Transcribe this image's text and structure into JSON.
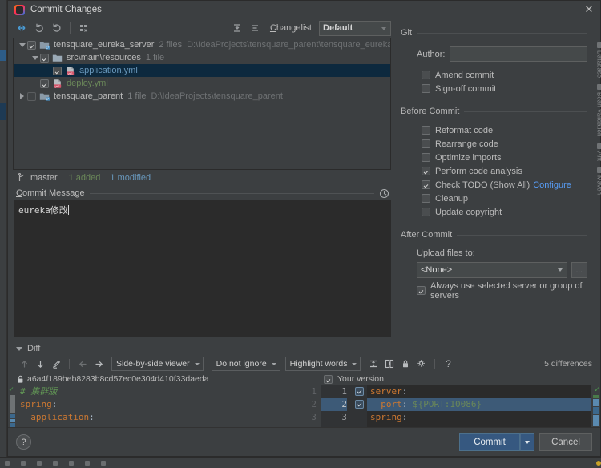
{
  "window": {
    "title": "Commit Changes",
    "app_icon": "intellij-idea-icon",
    "close_label": "✕"
  },
  "changes_toolbar": {
    "buttons": [
      {
        "name": "show-diff-icon",
        "title": "Show Diff"
      },
      {
        "name": "revert-icon",
        "title": "Revert"
      },
      {
        "name": "refresh-icon",
        "title": "Refresh"
      },
      {
        "name": "group-by-icon",
        "title": "Group By"
      }
    ],
    "expand_all": "expand-all-icon",
    "collapse_all": "collapse-all-icon",
    "changelist_label": "Changelist:",
    "changelist_value": "Default"
  },
  "tree": [
    {
      "indent": 0,
      "twisty": "open",
      "checked": true,
      "icon": "module-folder-icon",
      "name": "tensquare_eureka_server",
      "color": "default",
      "meta": "2 files",
      "path": "D:\\IdeaProjects\\tensquare_parent\\tensquare_eureka_server",
      "selected": false
    },
    {
      "indent": 1,
      "twisty": "open",
      "checked": true,
      "icon": "folder-icon",
      "name": "src\\main\\resources",
      "color": "default",
      "meta": "1 file",
      "path": "",
      "selected": false
    },
    {
      "indent": 2,
      "twisty": "none",
      "checked": true,
      "icon": "yaml-file-icon",
      "name": "application.yml",
      "color": "blue",
      "meta": "",
      "path": "",
      "selected": true
    },
    {
      "indent": 1,
      "twisty": "none",
      "checked": true,
      "icon": "yaml-file-icon",
      "name": "deploy.yml",
      "color": "green",
      "meta": "",
      "path": "",
      "selected": false
    },
    {
      "indent": 0,
      "twisty": "closed",
      "checked": false,
      "icon": "module-folder-icon",
      "name": "tensquare_parent",
      "color": "default",
      "meta": "1 file",
      "path": "D:\\IdeaProjects\\tensquare_parent",
      "selected": false
    }
  ],
  "branch_strip": {
    "branch_icon": "vcs-branch-icon",
    "branch": "master",
    "added": "1 added",
    "modified": "1 modified"
  },
  "commit_message": {
    "label": "Commit Message",
    "label_mnemonic": "C",
    "history_icon": "clock-history-icon",
    "value": "eureka修改"
  },
  "git_group": {
    "title": "Git",
    "author_label": "Author:",
    "author_mnemonic": "A",
    "author_value": "",
    "author_placeholder": "",
    "checkboxes": [
      {
        "label": "Amend commit",
        "mnemonic": "m",
        "checked": false,
        "name": "amend-commit-checkbox"
      },
      {
        "label": "Sign-off commit",
        "mnemonic": "",
        "checked": false,
        "name": "sign-off-commit-checkbox"
      }
    ]
  },
  "before_commit": {
    "title": "Before Commit",
    "checkboxes": [
      {
        "label": "Reformat code",
        "checked": false,
        "name": "reformat-code-checkbox",
        "link": ""
      },
      {
        "label": "Rearrange code",
        "checked": false,
        "name": "rearrange-code-checkbox",
        "link": ""
      },
      {
        "label": "Optimize imports",
        "checked": false,
        "name": "optimize-imports-checkbox",
        "link": ""
      },
      {
        "label": "Perform code analysis",
        "checked": true,
        "name": "perform-code-analysis-checkbox",
        "link": ""
      },
      {
        "label": "Check TODO (Show All)",
        "checked": true,
        "name": "check-todo-checkbox",
        "link": "Configure"
      },
      {
        "label": "Cleanup",
        "checked": false,
        "name": "cleanup-checkbox",
        "link": ""
      },
      {
        "label": "Update copyright",
        "checked": false,
        "name": "update-copyright-checkbox",
        "link": ""
      }
    ]
  },
  "after_commit": {
    "title": "After Commit",
    "upload_label": "Upload files to:",
    "upload_value": "<None>",
    "browse_label": "...",
    "always_use_label": "Always use selected server or group of servers",
    "always_use_checked": true
  },
  "tool_tabs": [
    "Database",
    "Bean Validation",
    "Ant",
    "Maven"
  ],
  "diff": {
    "section_title": "Diff",
    "nav_prev_icon": "arrow-up-icon",
    "nav_next_icon": "arrow-down-icon",
    "edit_icon": "pencil-icon",
    "accept_left_icon": "arrow-left-icon",
    "accept_right_icon": "arrow-right-icon",
    "viewer_mode": "Side-by-side viewer",
    "ignore_mode": "Do not ignore",
    "highlight_mode": "Highlight words",
    "collapse_icon": "collapse-unchanged-icon",
    "sync_scroll_icon": "sync-scroll-icon",
    "readonly_icon": "lock-icon",
    "settings_icon": "gear-icon",
    "help_icon": "question-mark-icon",
    "differences": "5 differences",
    "left_lock_icon": "lock-icon",
    "revision_hash": "a6a4f189beb8283b8cd57ec0e304d410f33daeda",
    "your_version_label": "Your version",
    "your_version_checked": true,
    "left_lines": [
      {
        "num": "1",
        "tokens": [
          {
            "t": "# 集群版",
            "c": "c"
          }
        ],
        "hl": false
      },
      {
        "num": "2",
        "tokens": [
          {
            "t": "spring",
            "c": "k"
          },
          {
            "t": ":",
            "c": "p"
          }
        ],
        "hl": false
      },
      {
        "num": "3",
        "tokens": [
          {
            "t": "  application",
            "c": "k"
          },
          {
            "t": ":",
            "c": "p"
          }
        ],
        "hl": false
      }
    ],
    "right_lines": [
      {
        "num": "1",
        "checked": true,
        "tokens": [
          {
            "t": "server",
            "c": "k"
          },
          {
            "t": ":",
            "c": "p"
          }
        ],
        "hl": false
      },
      {
        "num": "2",
        "checked": true,
        "tokens": [
          {
            "t": "  port",
            "c": "k"
          },
          {
            "t": ": ",
            "c": "p"
          },
          {
            "t": "${PORT:10086}",
            "c": "v"
          }
        ],
        "hl": true
      },
      {
        "num": "3",
        "checked": false,
        "tokens": [
          {
            "t": "spring",
            "c": "k"
          },
          {
            "t": ":",
            "c": "p"
          }
        ],
        "hl": false
      }
    ]
  },
  "buttons": {
    "help": "?",
    "commit": "Commit",
    "commit_dropdown_icon": "chevron-down-icon",
    "cancel": "Cancel"
  },
  "colors": {
    "accent": "#365880",
    "link": "#589df6",
    "added": "#6a8759",
    "modified": "#6897bb",
    "selection": "#0d293e",
    "background": "#3c3f41",
    "editor_background": "#2b2b2b"
  }
}
